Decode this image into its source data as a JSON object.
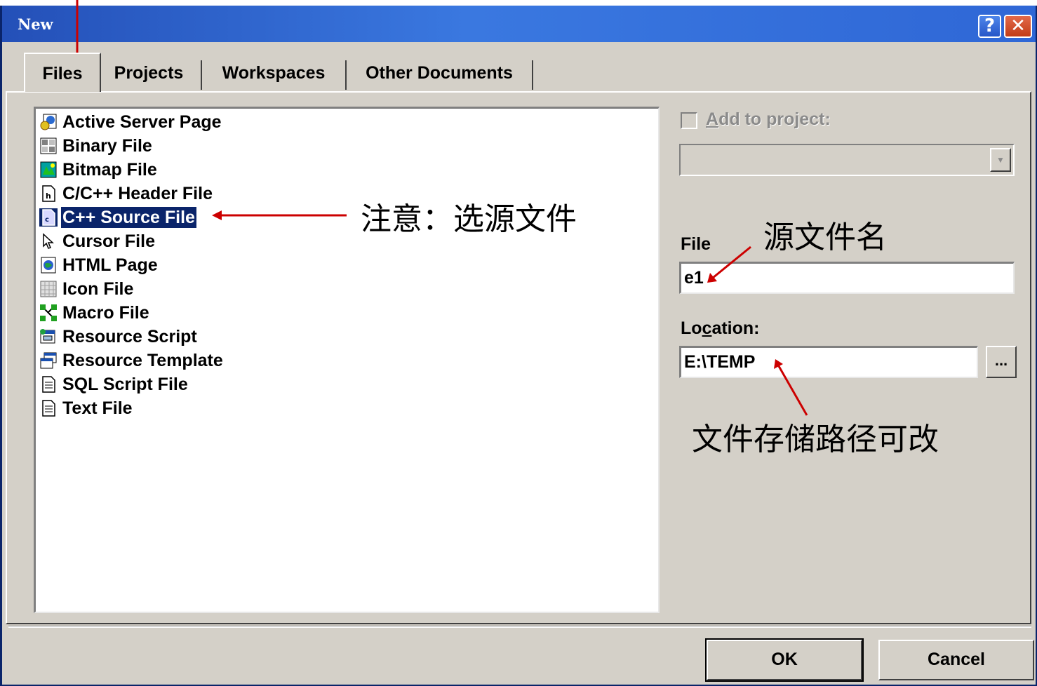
{
  "window": {
    "title": "New",
    "help_symbol": "?",
    "close_symbol": "✕"
  },
  "tabs": [
    {
      "label": "Files"
    },
    {
      "label": "Projects"
    },
    {
      "label": "Workspaces"
    },
    {
      "label": "Other Documents"
    }
  ],
  "file_types": [
    {
      "label": "Active Server Page",
      "icon": "asp-icon"
    },
    {
      "label": "Binary File",
      "icon": "binary-file-icon"
    },
    {
      "label": "Bitmap File",
      "icon": "bitmap-icon"
    },
    {
      "label": "C/C++ Header File",
      "icon": "header-file-icon"
    },
    {
      "label": "C++ Source File",
      "icon": "source-file-icon",
      "selected": true
    },
    {
      "label": "Cursor File",
      "icon": "cursor-icon"
    },
    {
      "label": "HTML Page",
      "icon": "html-icon"
    },
    {
      "label": "Icon File",
      "icon": "icon-file-icon"
    },
    {
      "label": "Macro File",
      "icon": "macro-icon"
    },
    {
      "label": "Resource Script",
      "icon": "resource-script-icon"
    },
    {
      "label": "Resource Template",
      "icon": "resource-template-icon"
    },
    {
      "label": "SQL Script File",
      "icon": "sql-file-icon"
    },
    {
      "label": "Text File",
      "icon": "text-file-icon"
    }
  ],
  "options": {
    "add_to_project_label": "Add to project:",
    "add_to_project_checked": false,
    "project_combo_value": "",
    "file_label": "File",
    "file_value": "e1",
    "location_label_pre": "Lo",
    "location_label_key": "c",
    "location_label_post": "ation:",
    "location_value": "E:\\TEMP",
    "browse_label": "..."
  },
  "buttons": {
    "ok": "OK",
    "cancel": "Cancel"
  },
  "annotations": {
    "select_source": "注意：选源文件",
    "source_name": "源文件名",
    "path_changeable": "文件存储路径可改"
  },
  "colors": {
    "selection": "#0a246a",
    "title_gradient_start": "#2450b8",
    "arrow": "#cc0000"
  }
}
